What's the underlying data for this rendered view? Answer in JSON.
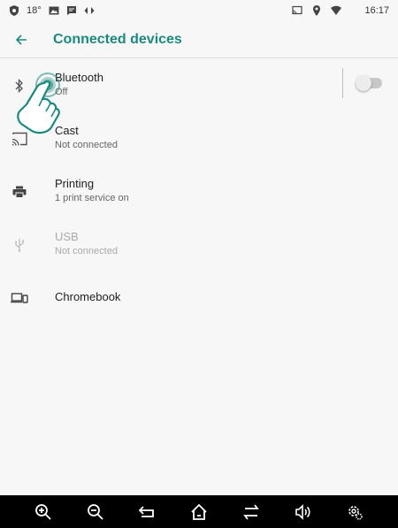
{
  "status_bar": {
    "left_text": "18°",
    "time": "16:17"
  },
  "app_bar": {
    "title": "Connected devices",
    "back_icon": "arrow-back-icon"
  },
  "items": [
    {
      "title": "Bluetooth",
      "subtitle": "Off",
      "icon": "bluetooth-icon",
      "toggle": "off"
    },
    {
      "title": "Cast",
      "subtitle": "Not connected",
      "icon": "cast-icon"
    },
    {
      "title": "Printing",
      "subtitle": "1 print service on",
      "icon": "printer-icon"
    },
    {
      "title": "USB",
      "subtitle": "Not connected",
      "icon": "usb-icon",
      "disabled": true
    },
    {
      "title": "Chromebook",
      "subtitle": "",
      "icon": "chromebook-icon"
    }
  ],
  "nav_bar": {
    "buttons": [
      "zoom-in-icon",
      "zoom-out-icon",
      "back-icon",
      "home-icon",
      "recents-icon",
      "volume-icon",
      "settings-icon"
    ]
  },
  "colors": {
    "accent": "#1a8a7e",
    "background": "#f7f7f7",
    "nav_background": "#000000"
  }
}
